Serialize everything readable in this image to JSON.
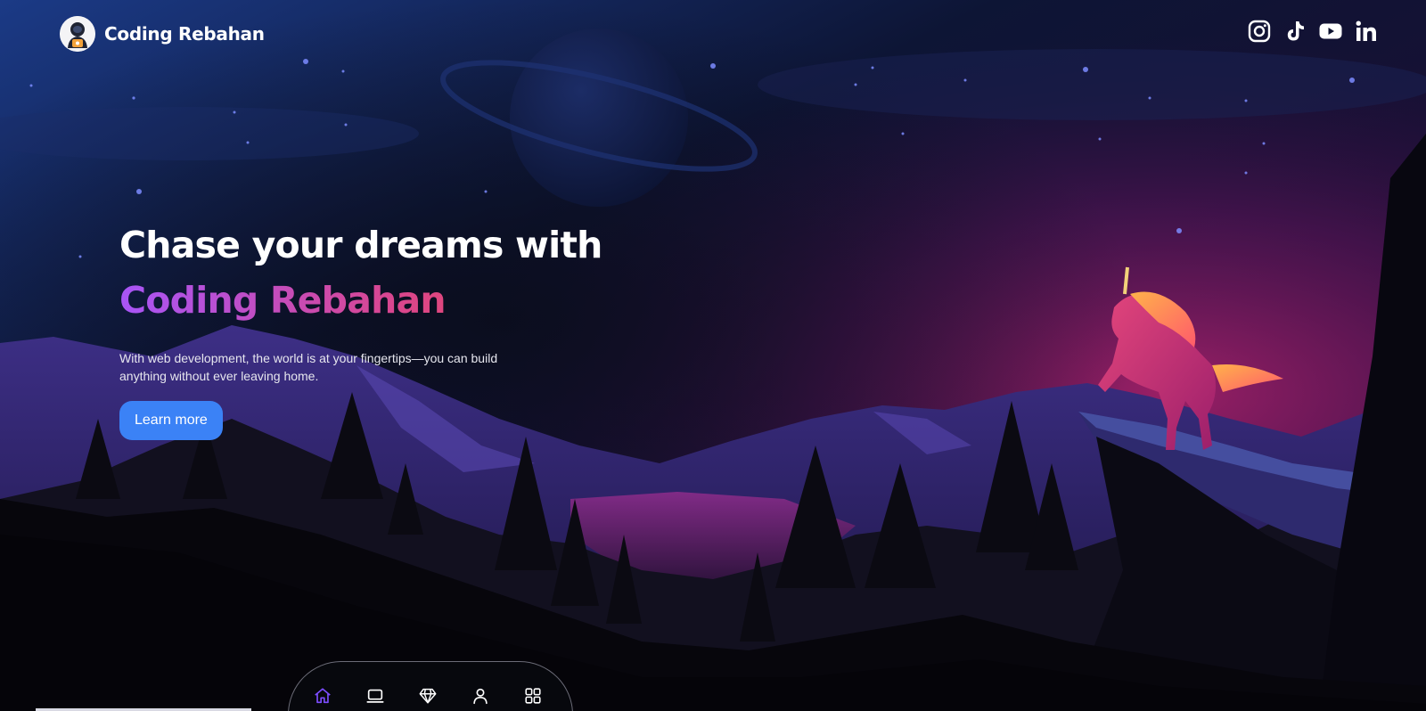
{
  "header": {
    "brand_name": "Coding Rebahan",
    "logo_icon": "astronaut-avatar-icon",
    "socials": [
      {
        "name": "instagram-icon"
      },
      {
        "name": "tiktok-icon"
      },
      {
        "name": "youtube-icon"
      },
      {
        "name": "linkedin-icon"
      }
    ]
  },
  "hero": {
    "title_line1": "Chase your dreams with",
    "title_line2": "Coding Rebahan",
    "description": "With web development, the world is at your fingertips—you can build anything without ever leaving home.",
    "cta_label": "Learn more"
  },
  "dock": {
    "items": [
      {
        "name": "home-icon",
        "active": true
      },
      {
        "name": "laptop-icon",
        "active": false
      },
      {
        "name": "diamond-icon",
        "active": false
      },
      {
        "name": "user-icon",
        "active": false
      },
      {
        "name": "grid-icon",
        "active": false
      }
    ]
  },
  "colors": {
    "accent_blue": "#3b82f6",
    "gradient_start": "#a855f7",
    "gradient_end": "#ef4444",
    "dock_active": "#7c4dff",
    "background": "#07080d"
  }
}
